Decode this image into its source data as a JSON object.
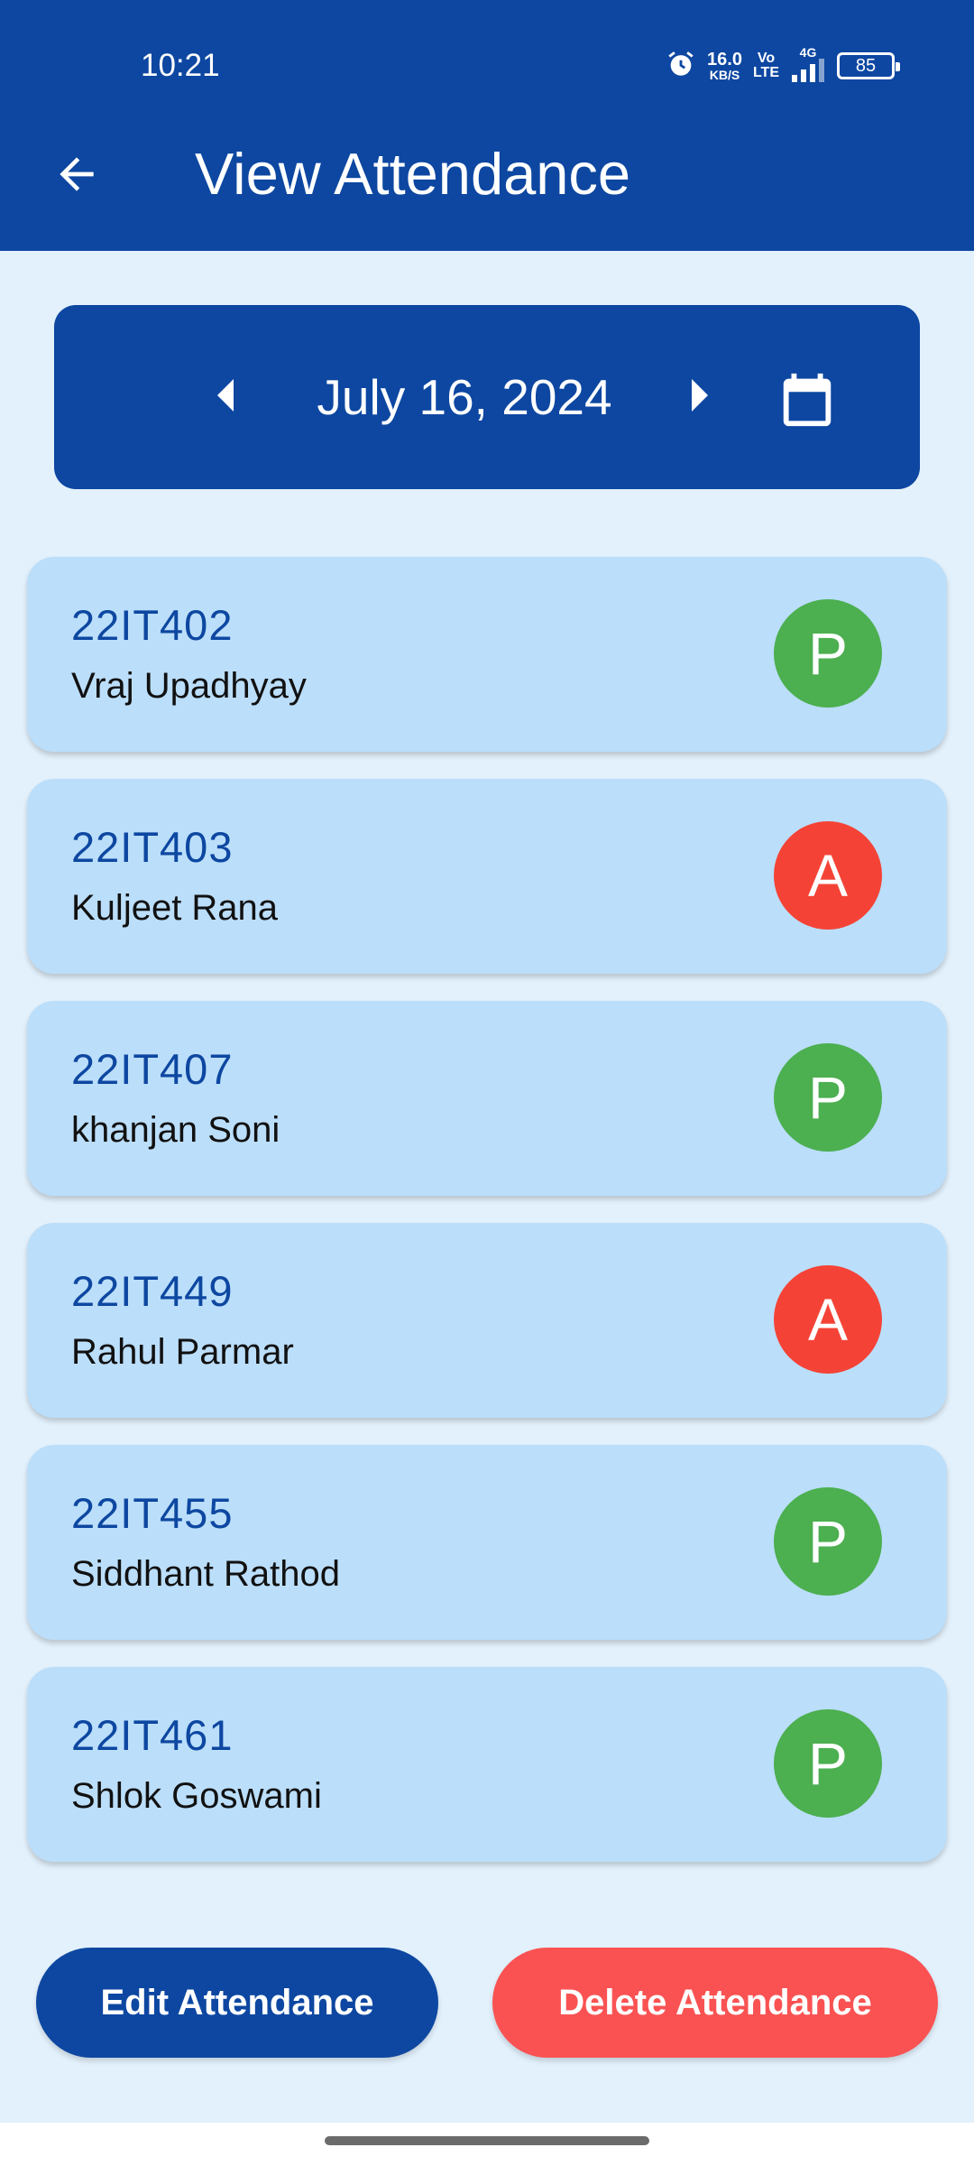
{
  "status_bar": {
    "time": "10:21",
    "net_speed_value": "16.0",
    "net_speed_unit": "KB/S",
    "volte_top": "Vo",
    "volte_bottom": "LTE",
    "network": "4G",
    "battery": "85",
    "icons": [
      "alarm-icon",
      "signal-icon",
      "battery-icon"
    ]
  },
  "app_bar": {
    "back_icon": "arrow-left-icon",
    "title": "View Attendance"
  },
  "date_selector": {
    "prev_icon": "caret-left-icon",
    "date": "July 16, 2024",
    "next_icon": "caret-right-icon",
    "calendar_icon": "calendar-icon"
  },
  "students": [
    {
      "id": "22IT402",
      "name": "Vraj Upadhyay",
      "status": "P"
    },
    {
      "id": "22IT403",
      "name": "Kuljeet Rana",
      "status": "A"
    },
    {
      "id": "22IT407",
      "name": "khanjan Soni",
      "status": "P"
    },
    {
      "id": "22IT449",
      "name": "Rahul Parmar",
      "status": "A"
    },
    {
      "id": "22IT455",
      "name": "Siddhant Rathod",
      "status": "P"
    },
    {
      "id": "22IT461",
      "name": "Shlok Goswami",
      "status": "P"
    }
  ],
  "actions": {
    "edit_label": "Edit Attendance",
    "delete_label": "Delete Attendance"
  },
  "colors": {
    "primary": "#0d47a1",
    "background": "#e3f1fc",
    "card": "#bbdefa",
    "present": "#4caf50",
    "absent": "#f44336",
    "delete": "#fa5252"
  }
}
